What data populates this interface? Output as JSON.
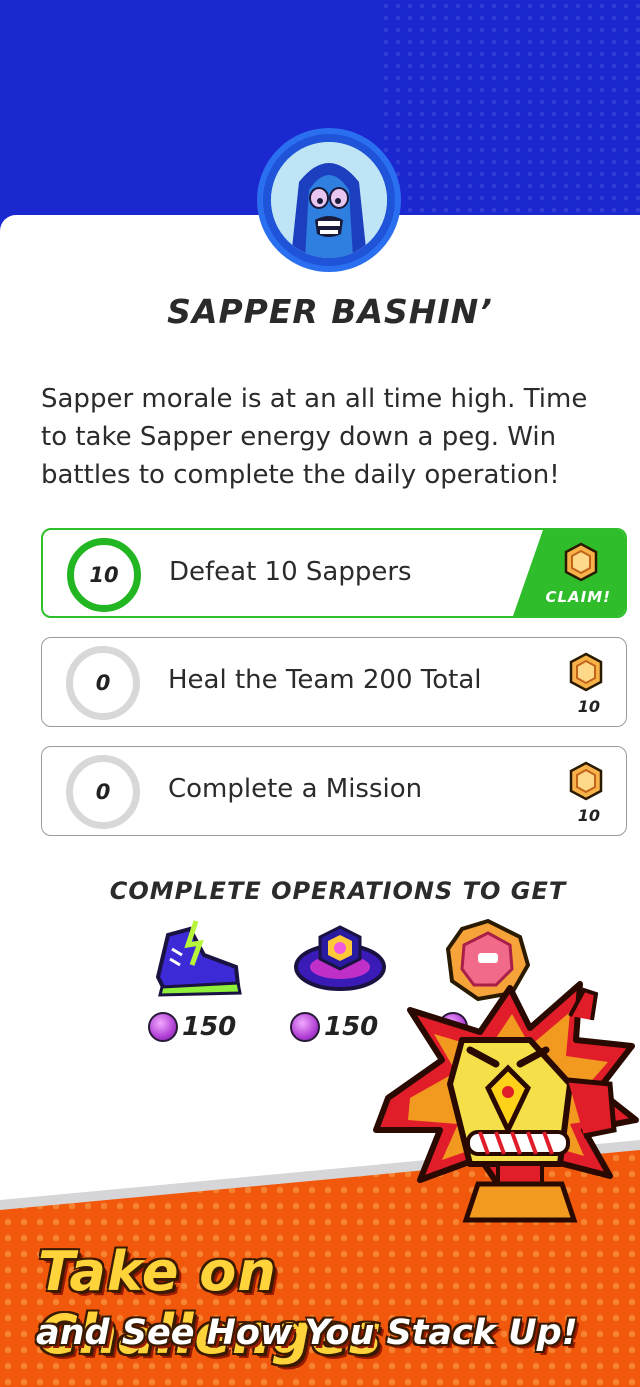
{
  "operation": {
    "title": "SAPPER BASHIN’",
    "description": "Sapper morale is at an all time high. Time to take Sapper energy down a peg. Win battles to complete the daily operation!"
  },
  "tasks": [
    {
      "count": "10",
      "label": "Defeat 10 Sappers",
      "action": "CLAIM!",
      "status": "complete"
    },
    {
      "count": "0",
      "label": "Heal the Team 200 Total",
      "reward": "10"
    },
    {
      "count": "0",
      "label": "Complete a Mission",
      "reward": "10"
    }
  ],
  "rewards": {
    "title": "COMPLETE OPERATIONS TO GET",
    "items": [
      {
        "icon": "sneaker-icon",
        "price": "150"
      },
      {
        "icon": "wristband-icon",
        "price": "150"
      },
      {
        "icon": "ruby-medal-icon",
        "price": ""
      }
    ]
  },
  "promo": {
    "headline": "Take on Challenges",
    "subheadline": "and See How You Stack Up!"
  },
  "colors": {
    "header_blue": "#1b27cf",
    "claim_green": "#2fbd2b",
    "promo_orange": "#f1580b",
    "headline_yellow": "#ffd33a"
  }
}
